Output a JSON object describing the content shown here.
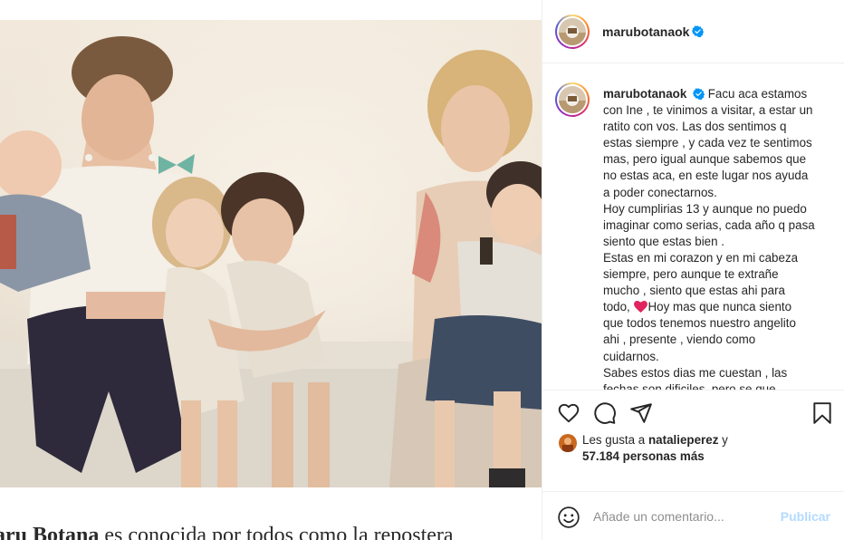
{
  "post": {
    "username": "marubotanaok",
    "verified": true
  },
  "caption": {
    "username": "marubotanaok",
    "lines": [
      "Facu aca estamos",
      "con Ine , te vinimos a visitar, a estar un",
      "ratito con vos. Las dos sentimos q",
      "estas siempre , y cada vez te sentimos",
      "mas, pero igual aunque sabemos que",
      "no estas aca, en este lugar nos ayuda",
      "a poder conectarnos.",
      "Hoy cumplirias 13 y aunque no puedo",
      "imaginar como serias, cada año q pasa",
      "siento que estas bien .",
      "Estas en mi corazon y en mi cabeza",
      "siempre, pero aunque te extrañe",
      "mucho , siento que estas ahi para",
      "Hoy mas que nunca siento",
      "que todos tenemos nuestro angelito",
      "ahi , presente , viendo como",
      "cuidarnos.",
      "Sabes estos dias me cuestan , las",
      "fechas son dificiles, pero se que"
    ],
    "line14_prefix": "todo, "
  },
  "likes": {
    "prefix": "Les gusta a",
    "liker": "natalieperez",
    "conjunction": "y",
    "count_text": "57.184 personas más"
  },
  "comment": {
    "placeholder": "Añade un comentario...",
    "publish_label": "Publicar"
  },
  "article": {
    "caption_bold": "aru Botana",
    "caption_rest": " es conocida por todos como la repostera"
  },
  "icons": {
    "like": "heart-outline-icon",
    "comment": "comment-bubble-icon",
    "share": "paper-plane-icon",
    "save": "bookmark-icon",
    "emoji": "smiley-icon",
    "verified": "verified-badge-icon"
  },
  "colors": {
    "verified": "#0095f6",
    "publish_disabled": "#b3dbff",
    "heart_emoji": "#e0245e"
  }
}
